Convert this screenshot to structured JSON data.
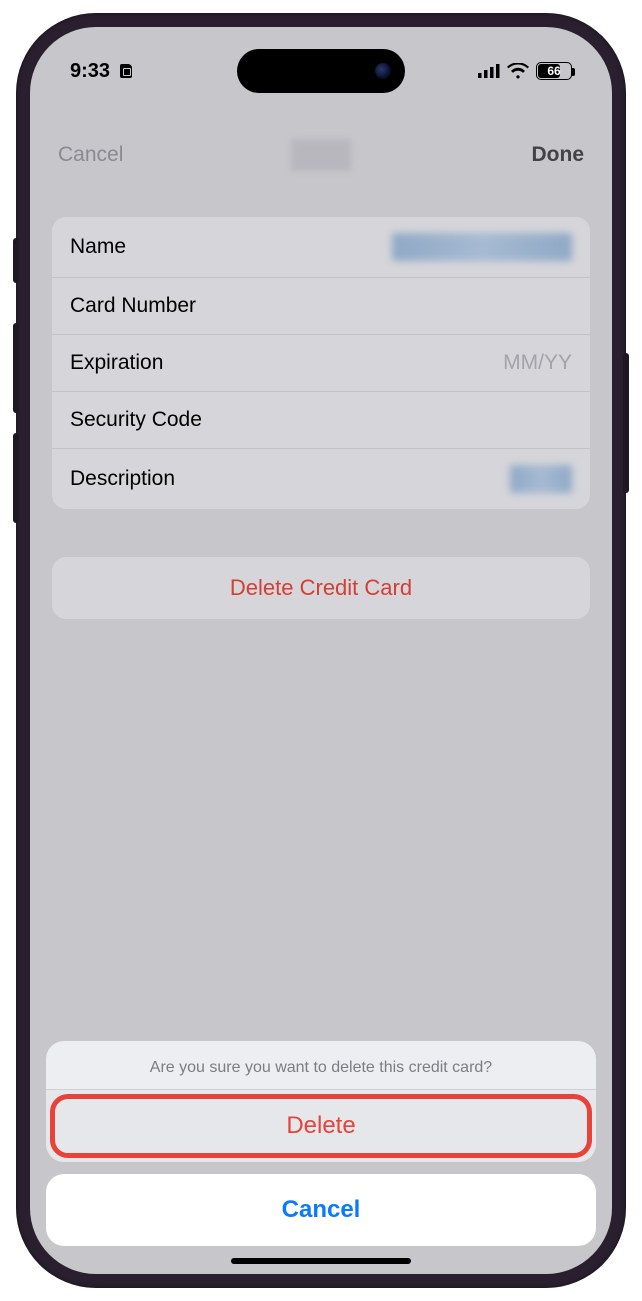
{
  "status": {
    "time": "9:33",
    "battery_pct": "66"
  },
  "nav": {
    "cancel": "Cancel",
    "done": "Done"
  },
  "form": {
    "name_label": "Name",
    "card_label": "Card Number",
    "exp_label": "Expiration",
    "exp_placeholder": "MM/YY",
    "sec_label": "Security Code",
    "desc_label": "Description"
  },
  "delete_card_btn": "Delete Credit Card",
  "sheet": {
    "title": "Are you sure you want to delete this credit card?",
    "delete": "Delete",
    "cancel": "Cancel"
  }
}
